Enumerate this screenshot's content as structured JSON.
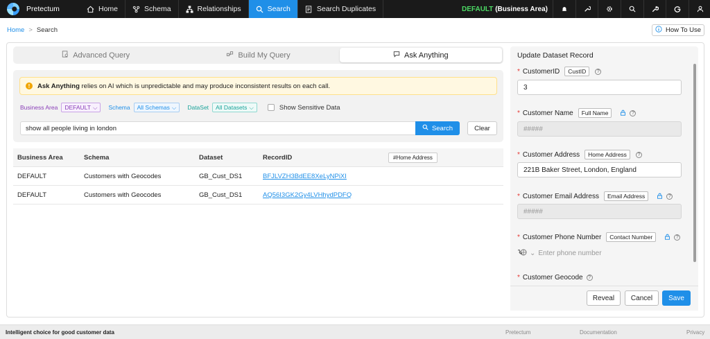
{
  "nav": {
    "brand": "Pretectum",
    "items": [
      {
        "label": "Home",
        "icon": "home-icon"
      },
      {
        "label": "Schema",
        "icon": "schema-icon"
      },
      {
        "label": "Relationships",
        "icon": "relationships-icon"
      },
      {
        "label": "Search",
        "icon": "search-icon",
        "active": true
      },
      {
        "label": "Search Duplicates",
        "icon": "duplicates-icon"
      }
    ],
    "business_area_prefix": "DEFAULT",
    "business_area_suffix": "(Business Area)",
    "right_icons": [
      "bell-icon",
      "wrench-icon",
      "gear-icon",
      "zoom-icon",
      "tools-icon",
      "google-icon",
      "user-icon"
    ]
  },
  "breadcrumb": {
    "home": "Home",
    "separator": ">",
    "current": "Search"
  },
  "how_to_use": "How To Use",
  "tabs": [
    {
      "label": "Advanced Query",
      "icon": "query-icon"
    },
    {
      "label": "Build My Query",
      "icon": "build-icon"
    },
    {
      "label": "Ask Anything",
      "icon": "chat-icon",
      "active": true
    }
  ],
  "warning": {
    "bold": "Ask Anything",
    "text": "relies on AI which is unpredictable and may produce inconsistent results on each call."
  },
  "filters": {
    "business_area_label": "Business Area",
    "business_area_value": "DEFAULT",
    "schema_label": "Schema",
    "schema_value": "All Schemas",
    "dataset_label": "DataSet",
    "dataset_value": "All Datasets",
    "sensitive_label": "Show Sensitive Data"
  },
  "query": {
    "value": "show all people living in london",
    "search_label": "Search",
    "clear_label": "Clear"
  },
  "results": {
    "columns": [
      "Business Area",
      "Schema",
      "Dataset",
      "RecordID"
    ],
    "extra_column": "#Home Address",
    "rows": [
      {
        "business_area": "DEFAULT",
        "schema": "Customers with Geocodes",
        "dataset": "GB_Cust_DS1",
        "record_id": "BFJLVZH3BdEE8XeLyNPiXI"
      },
      {
        "business_area": "DEFAULT",
        "schema": "Customers with Geocodes",
        "dataset": "GB_Cust_DS1",
        "record_id": "AQ56I3GK2Gy4LVHhydPDFQ"
      }
    ]
  },
  "update_panel": {
    "title": "Update Dataset Record",
    "fields": [
      {
        "label": "CustomerID",
        "tag": "CustID",
        "value": "3",
        "locked": false
      },
      {
        "label": "Customer Name",
        "tag": "Full Name",
        "value": "#####",
        "locked": true
      },
      {
        "label": "Customer Address",
        "tag": "Home Address",
        "value": "221B Baker Street, London, England",
        "locked": false
      },
      {
        "label": "Customer Email Address",
        "tag": "Email Address",
        "value": "#####",
        "locked": true
      },
      {
        "label": "Customer Phone Number",
        "tag": "Contact Number",
        "placeholder": "Enter phone number",
        "locked": true
      },
      {
        "label": "Customer Geocode"
      }
    ],
    "buttons": {
      "reveal": "Reveal",
      "cancel": "Cancel",
      "save": "Save"
    }
  },
  "footer": {
    "tagline": "Intelligent choice for good customer data",
    "links": [
      "Pretectum",
      "Documentation",
      "Privacy"
    ]
  },
  "colors": {
    "accent": "#1f8fe8",
    "business_area": "#4cd964",
    "required": "#e53935",
    "warning_bg": "#fff8e1"
  }
}
